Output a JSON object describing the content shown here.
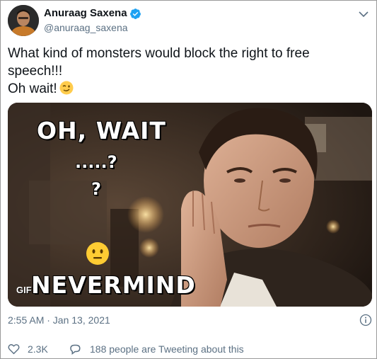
{
  "author": {
    "display_name": "Anuraag Saxena",
    "handle": "@anuraag_saxena",
    "verified": true,
    "avatar_icon": "profile-photo"
  },
  "tweet": {
    "text_lines": [
      "What kind of monsters would block the right to free",
      "speech!!!",
      "Oh wait!"
    ],
    "emoji": "winking-face"
  },
  "media": {
    "type": "GIF",
    "badge": "GIF",
    "caption_lines": [
      "OH, WAIT",
      ".....?",
      "?",
      "NEVERMIND"
    ],
    "emoji": "neutral-face"
  },
  "meta": {
    "timestamp": "2:55 AM · Jan 13, 2021"
  },
  "actions": {
    "like_count": "2.3K",
    "conversation_text": "188 people are Tweeting about this"
  },
  "colors": {
    "text": "#0f1419",
    "secondary": "#5b7083",
    "verified": "#1da1f2",
    "border": "#9a9a9a"
  }
}
